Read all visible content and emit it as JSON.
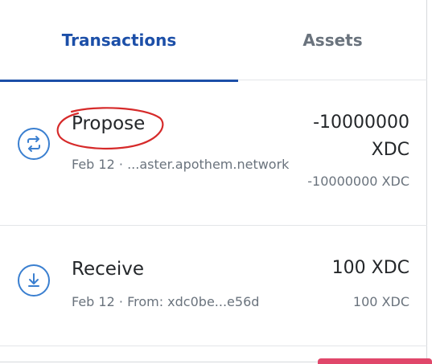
{
  "tabs": [
    {
      "label": "Transactions",
      "active": true
    },
    {
      "label": "Assets",
      "active": false
    }
  ],
  "transactions": [
    {
      "title": "Propose",
      "date": "Feb 12",
      "separator": "·",
      "detail": "...aster.apothem.network",
      "primary_amount_line1": "-10000000",
      "primary_amount_line2": "XDC",
      "secondary_amount": "-10000000 XDC",
      "icon": "swap-arrows-icon"
    },
    {
      "title": "Receive",
      "date": "Feb 12",
      "separator": "·",
      "detail": "From: xdc0be...e56d",
      "primary_amount": "100 XDC",
      "secondary_amount": "100 XDC",
      "icon": "download-arrow-icon"
    }
  ],
  "colors": {
    "accent": "#1c4fa8",
    "icon_blue": "#3a7fd0",
    "annotation_red": "#d62a2a",
    "muted_text": "#6a737d"
  }
}
